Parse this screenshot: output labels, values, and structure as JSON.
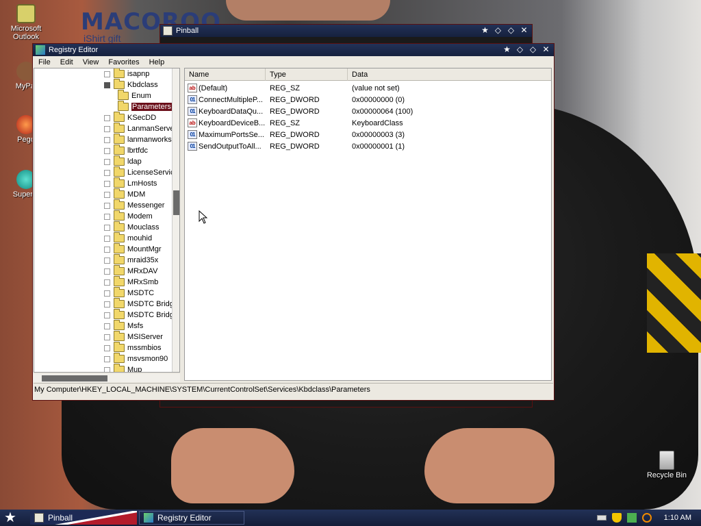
{
  "desktop": {
    "wallpaper_text": {
      "logo": "MACOROO",
      "sub": "iShirt gift"
    },
    "icons": [
      {
        "label": "Microsoft Outlook",
        "icon": "outlook-icon"
      },
      {
        "label": "MyPal",
        "icon": "mypal-icon"
      },
      {
        "label": "Pego",
        "icon": "pego-icon"
      },
      {
        "label": "Superm",
        "icon": "superm-icon"
      },
      {
        "label": "Recycle Bin",
        "icon": "recycle-bin-icon"
      }
    ]
  },
  "pinball_window": {
    "title": "Pinball"
  },
  "registry_editor": {
    "title": "Registry Editor",
    "menu": [
      "File",
      "Edit",
      "View",
      "Favorites",
      "Help"
    ],
    "tree": [
      {
        "label": "isapnp",
        "level": 1,
        "expander": "+"
      },
      {
        "label": "Kbdclass",
        "level": 1,
        "expander": "-"
      },
      {
        "label": "Enum",
        "level": 2,
        "expander": ""
      },
      {
        "label": "Parameters",
        "level": 2,
        "expander": "",
        "selected": true
      },
      {
        "label": "KSecDD",
        "level": 1,
        "expander": "+"
      },
      {
        "label": "LanmanServer",
        "level": 1,
        "expander": "+"
      },
      {
        "label": "lanmanworkstation",
        "level": 1,
        "expander": "+"
      },
      {
        "label": "lbrtfdc",
        "level": 1,
        "expander": ""
      },
      {
        "label": "ldap",
        "level": 1,
        "expander": ""
      },
      {
        "label": "LicenseService",
        "level": 1,
        "expander": "+"
      },
      {
        "label": "LmHosts",
        "level": 1,
        "expander": "+"
      },
      {
        "label": "MDM",
        "level": 1,
        "expander": "+"
      },
      {
        "label": "Messenger",
        "level": 1,
        "expander": "+"
      },
      {
        "label": "Modem",
        "level": 1,
        "expander": "+"
      },
      {
        "label": "Mouclass",
        "level": 1,
        "expander": "+"
      },
      {
        "label": "mouhid",
        "level": 1,
        "expander": "+"
      },
      {
        "label": "MountMgr",
        "level": 1,
        "expander": "+"
      },
      {
        "label": "mraid35x",
        "level": 1,
        "expander": "+"
      },
      {
        "label": "MRxDAV",
        "level": 1,
        "expander": "+"
      },
      {
        "label": "MRxSmb",
        "level": 1,
        "expander": "+"
      },
      {
        "label": "MSDTC",
        "level": 1,
        "expander": "+"
      },
      {
        "label": "MSDTC Bridge",
        "level": 1,
        "expander": "+"
      },
      {
        "label": "MSDTC Bridge",
        "level": 1,
        "expander": "+"
      },
      {
        "label": "Msfs",
        "level": 1,
        "expander": "+"
      },
      {
        "label": "MSIServer",
        "level": 1,
        "expander": "+"
      },
      {
        "label": "mssmbios",
        "level": 1,
        "expander": "+"
      },
      {
        "label": "msvsmon90",
        "level": 1,
        "expander": "+"
      },
      {
        "label": "Mup",
        "level": 1,
        "expander": "+"
      }
    ],
    "columns": [
      "Name",
      "Type",
      "Data"
    ],
    "values": [
      {
        "name": "(Default)",
        "type": "REG_SZ",
        "data": "(value not set)",
        "kind": "sz"
      },
      {
        "name": "ConnectMultipleP...",
        "type": "REG_DWORD",
        "data": "0x00000000 (0)",
        "kind": "dw"
      },
      {
        "name": "KeyboardDataQu...",
        "type": "REG_DWORD",
        "data": "0x00000064 (100)",
        "kind": "dw"
      },
      {
        "name": "KeyboardDeviceB...",
        "type": "REG_SZ",
        "data": "KeyboardClass",
        "kind": "sz"
      },
      {
        "name": "MaximumPortsSe...",
        "type": "REG_DWORD",
        "data": "0x00000003 (3)",
        "kind": "dw"
      },
      {
        "name": "SendOutputToAll...",
        "type": "REG_DWORD",
        "data": "0x00000001 (1)",
        "kind": "dw"
      }
    ],
    "status_path": "My Computer\\HKEY_LOCAL_MACHINE\\SYSTEM\\CurrentControlSet\\Services\\Kbdclass\\Parameters"
  },
  "taskbar": {
    "buttons": [
      {
        "label": "Pinball",
        "icon": "pinball-icon"
      },
      {
        "label": "Registry Editor",
        "icon": "registry-editor-icon"
      }
    ],
    "clock": "1:10 AM"
  },
  "colors": {
    "titlebar": "#1b2748",
    "selection": "#6b0f1a"
  }
}
